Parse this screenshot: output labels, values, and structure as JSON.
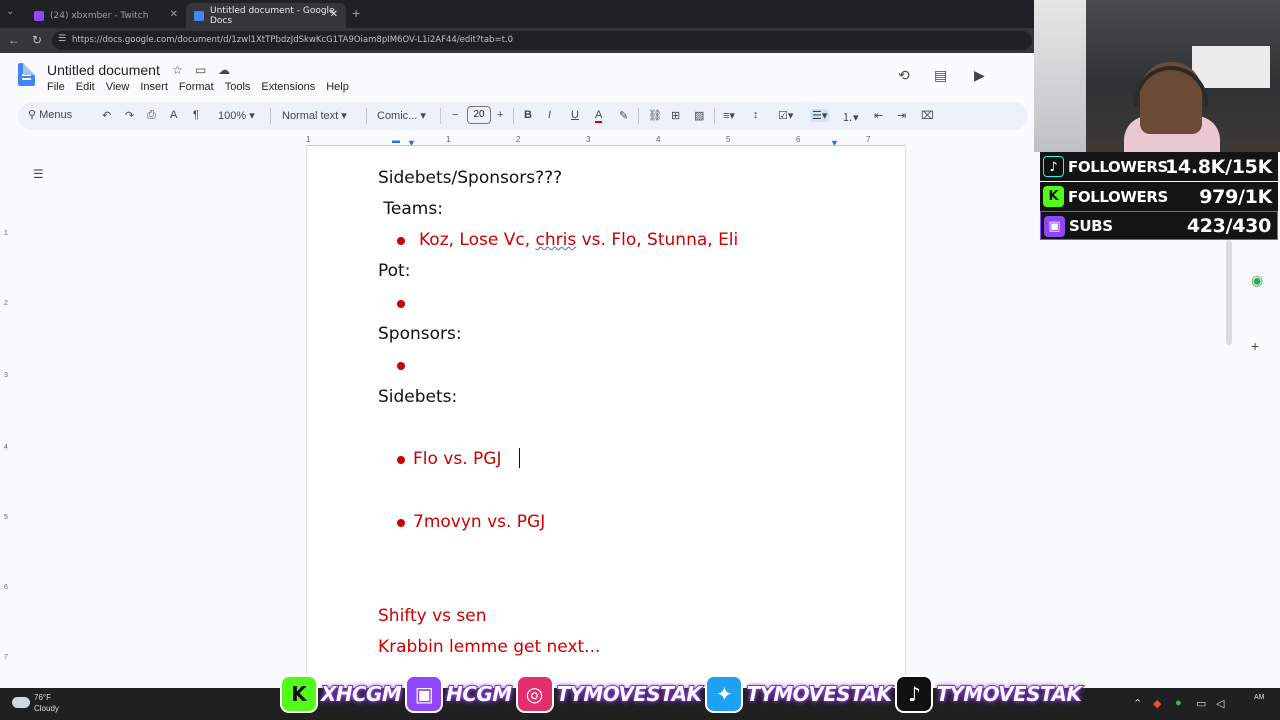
{
  "browser": {
    "tabs": [
      {
        "title": "(24) xbxmber - Twitch",
        "active": false,
        "favicon_color": "#9146ff"
      },
      {
        "title": "Untitled document - Google Docs",
        "active": true,
        "favicon_color": "#4285f4"
      }
    ],
    "url": "https://docs.google.com/document/d/1zwl1XtTPbdzJdSkwKcG1TA9Oiam8pIM6OV-L1i2AF44/edit?tab=t.0"
  },
  "docs": {
    "title": "Untitled document",
    "menus": [
      "File",
      "Edit",
      "View",
      "Insert",
      "Format",
      "Tools",
      "Extensions",
      "Help"
    ],
    "toolbar": {
      "search_menus": "Menus",
      "zoom": "100%",
      "style": "Normal text",
      "font": "Comic...",
      "font_size": "20"
    },
    "ruler_numbers": [
      "1",
      "1",
      "2",
      "3",
      "4",
      "5",
      "6",
      "7"
    ]
  },
  "document": {
    "heading": "Sidebets/Sponsors???",
    "teams_label": " Teams:",
    "teams_item_pre": "Koz, Lose Vc, ",
    "teams_item_squiggle": "chris",
    "teams_item_post": " vs. Flo, Stunna, Eli",
    "pot_label": "Pot:",
    "sponsors_label": "Sponsors:",
    "sidebets_label": "Sidebets:",
    "sidebet_1": "Flo vs. PGJ ",
    "sidebet_2": "7movyn vs. PGJ",
    "line_shifty": "Shifty vs sen",
    "line_krabbin": "Krabbin lemme get next..."
  },
  "stream": {
    "counters": [
      {
        "label": "FOLLOWERS",
        "value": "14.8K/15K",
        "badge": "♪",
        "badge_color": "#111111"
      },
      {
        "label": "FOLLOWERS",
        "value": "979/1K",
        "badge": "K",
        "badge_color": "#53fc18"
      },
      {
        "label": "SUBS",
        "value": "423/430",
        "badge": "▣",
        "badge_color": "#9146ff"
      }
    ],
    "socials": [
      {
        "icon": "K",
        "text": "XHCGM",
        "color": "#53fc18"
      },
      {
        "icon": "▣",
        "text": "HCGM",
        "color": "#9146ff"
      },
      {
        "icon": "◎",
        "text": "TYMOVESTAK",
        "color": "#e1306c"
      },
      {
        "icon": "✦",
        "text": "TYMOVESTAK",
        "color": "#1da1f2"
      },
      {
        "icon": "♪",
        "text": "TYMOVESTAK",
        "color": "#111111"
      }
    ]
  },
  "taskbar": {
    "temperature": "76°F",
    "condition": "Cloudy",
    "time": "AM"
  }
}
